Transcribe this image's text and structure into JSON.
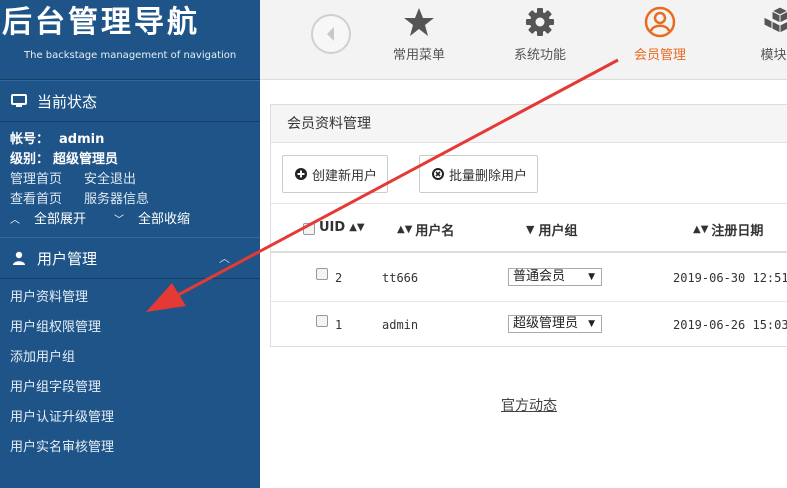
{
  "brand": {
    "title": "后台管理导航",
    "subtitle": "The backstage management of navigation"
  },
  "sidebar": {
    "status_section": "当前状态",
    "account_label": "帐号：",
    "account_value": "admin",
    "level_label": "级别：",
    "level_value": "超级管理员",
    "links": [
      "管理首页",
      "安全退出",
      "查看首页",
      "服务器信息"
    ],
    "expand_all": "全部展开",
    "collapse_all": "全部收缩",
    "user_section": "用户管理",
    "menu": [
      "用户资料管理",
      "用户组权限管理",
      "添加用户组",
      "用户组字段管理",
      "用户认证升级管理",
      "用户实名审核管理"
    ]
  },
  "topnav": {
    "items": [
      "常用菜单",
      "系统功能",
      "会员管理",
      "模块中"
    ],
    "active": "会员管理",
    "active_color": "#e86b1f"
  },
  "panel": {
    "title": "会员资料管理",
    "create_button": "创建新用户",
    "batch_delete_button": "批量删除用户",
    "columns": [
      "UID",
      "用户名",
      "用户组",
      "注册日期"
    ],
    "rows": [
      {
        "uid": "2",
        "username": "tt666",
        "group": "普通会员",
        "date": "2019-06-30 12:51"
      },
      {
        "uid": "1",
        "username": "admin",
        "group": "超级管理员",
        "date": "2019-06-26 15:03"
      }
    ]
  },
  "footer": {
    "link": "官方动态"
  },
  "colors": {
    "sidebar_bg": "#1e5487",
    "annotation_arrow": "#e53935"
  }
}
